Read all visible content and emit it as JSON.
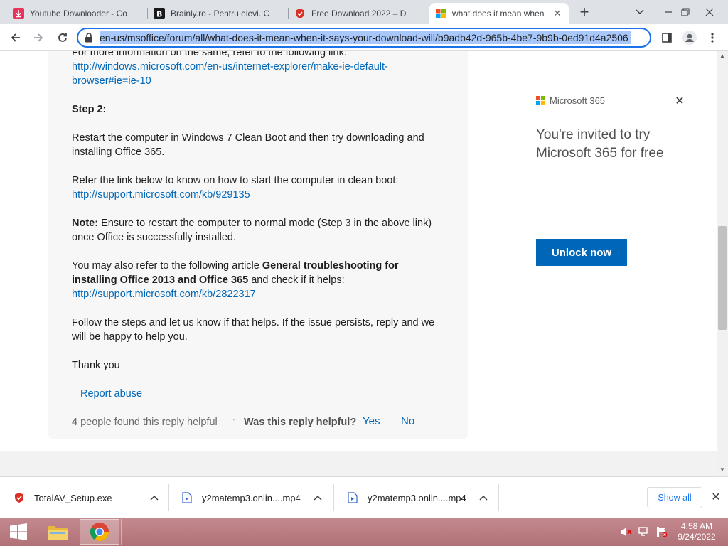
{
  "tabs": [
    {
      "title": "Youtube Downloader - Co",
      "icon": "download-icon"
    },
    {
      "title": "Brainly.ro - Pentru elevi. C",
      "icon": "brainly-icon"
    },
    {
      "title": "Free Download 2022 – D",
      "icon": "shield-icon"
    },
    {
      "title": "what does it mean when",
      "icon": "microsoft-icon",
      "active": true
    }
  ],
  "toolbar": {
    "url": "en-us/msoffice/forum/all/what-does-it-mean-when-it-says-your-download-will/b9adb42d-965b-4be7-9b9b-0ed91d4a2506"
  },
  "post": {
    "line_more_info": "For more information on the same, refer to the following link:",
    "link_ie_1": "http://windows.microsoft.com/en-us/internet-explorer/make-ie-default-",
    "link_ie_2": "browser#ie=ie-10",
    "step2": "Step 2:",
    "restart_1": "Restart the computer in Windows 7 Clean Boot and then try downloading and",
    "restart_2": "installing Office 365.",
    "refer_clean": "Refer the link below to know on how to start the computer in clean boot:",
    "link_kb1": "http://support.microsoft.com/kb/929135",
    "note_label": "Note:",
    "note_1": " Ensure to restart the computer to normal mode (Step 3 in the above link)",
    "note_2": "once Office is successfully installed.",
    "also_pre": "You may also refer to the following article ",
    "also_bold_1": "General troubleshooting for",
    "also_bold_2": "installing Office 2013 and Office 365",
    "also_post": " and check if it helps:",
    "link_kb2": "http://support.microsoft.com/kb/2822317",
    "follow_1": "Follow the steps and let us know if that helps. If the issue persists, reply and we",
    "follow_2": "will be happy to help you.",
    "thanks": "Thank you",
    "report": "Report abuse",
    "helpful_count": "4 people found this reply helpful",
    "helpful_question": "Was this reply helpful?",
    "yes": "Yes",
    "no": "No"
  },
  "ad": {
    "brand": "Microsoft 365",
    "headline": "You're invited to try Microsoft 365 for free",
    "button": "Unlock now"
  },
  "downloads": {
    "items": [
      {
        "name": "TotalAV_Setup.exe",
        "icon": "totalav-shield-icon"
      },
      {
        "name": "y2matemp3.onlin....mp4",
        "icon": "media-file-icon"
      },
      {
        "name": "y2matemp3.onlin....mp4",
        "icon": "media-file-icon"
      }
    ],
    "show_all": "Show all"
  },
  "taskbar": {
    "time": "4:58 AM",
    "date": "9/24/2022"
  },
  "colors": {
    "accent": "#1a73e8",
    "link": "#0067b8",
    "taskbar": "#b87a80"
  }
}
